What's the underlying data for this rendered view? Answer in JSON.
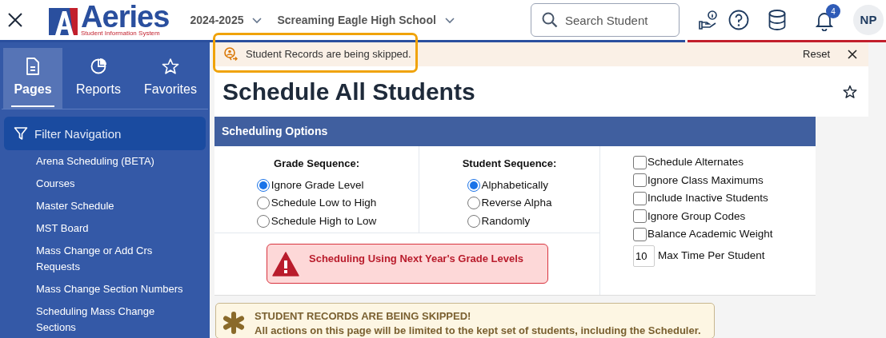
{
  "header": {
    "year": "2024-2025",
    "school": "Screaming Eagle High School",
    "search": {
      "placeholder": "Search Student"
    },
    "notifications": "4",
    "avatar": "NP",
    "logo": {
      "name": "Aeries",
      "tagline": "Student Information System"
    }
  },
  "sidebar": {
    "tabs": [
      {
        "label": "Pages",
        "kind": "page",
        "selected": true
      },
      {
        "label": "Reports",
        "kind": "pie",
        "selected": false
      },
      {
        "label": "Favorites",
        "kind": "star",
        "selected": false
      }
    ],
    "filter": {
      "placeholder": "Filter Navigation"
    },
    "items": [
      "Arena Scheduling (BETA)",
      "Courses",
      "Master Schedule",
      "MST Board",
      "Mass Change or Add Crs Requests",
      "Mass Change Section Numbers",
      "Scheduling Mass Change Sections"
    ]
  },
  "banner": {
    "text": "Student Records are being skipped.",
    "action": "Reset",
    "highlighted": true
  },
  "page": {
    "title": "Schedule All Students"
  },
  "panel": {
    "title": "Scheduling Options",
    "groups": [
      {
        "heading": "Grade Sequence:",
        "options": [
          {
            "label": "Ignore Grade Level",
            "selected": true
          },
          {
            "label": "Schedule Low to High",
            "selected": false
          },
          {
            "label": "Schedule High to Low",
            "selected": false
          }
        ]
      },
      {
        "heading": "Student Sequence:",
        "options": [
          {
            "label": "Alphabetically",
            "selected": true
          },
          {
            "label": "Reverse Alpha",
            "selected": false
          },
          {
            "label": "Randomly",
            "selected": false
          }
        ]
      }
    ],
    "checks": [
      {
        "label": "Schedule Alternates",
        "checked": false
      },
      {
        "label": "Ignore Class Maximums",
        "checked": false
      },
      {
        "label": "Include Inactive Students",
        "checked": false
      },
      {
        "label": "Ignore Group Codes",
        "checked": false
      },
      {
        "label": "Balance Academic Weight",
        "checked": false
      }
    ],
    "max_time": {
      "value": "10",
      "label": "Max Time Per Student"
    },
    "alert": "Scheduling Using Next Year's Grade Levels"
  },
  "notice": {
    "title": "STUDENT RECORDS ARE BEING SKIPPED!",
    "text": "All actions on this page will be limited to the kept set of students, including the Scheduler."
  }
}
